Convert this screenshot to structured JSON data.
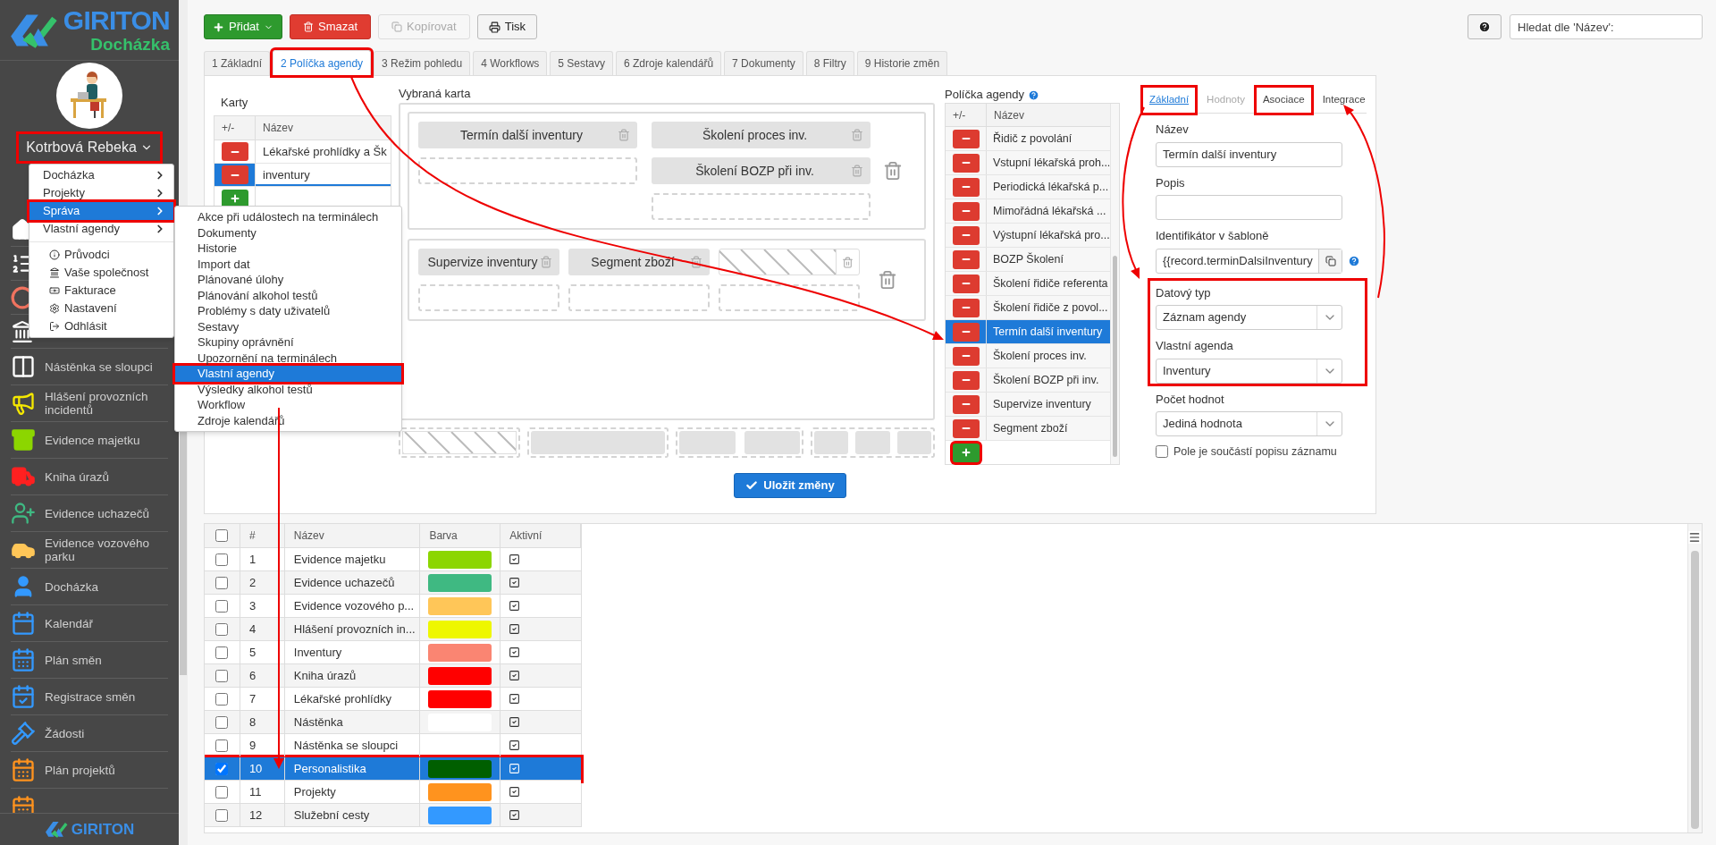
{
  "brand": {
    "name": "GIRITON",
    "product": "Docházka"
  },
  "user": {
    "name": "Kotrbová Rebeka",
    "annotated": true
  },
  "user_menu": {
    "items": [
      {
        "label": "Docházka",
        "kind": "submenu",
        "selected": false,
        "annotated": false
      },
      {
        "label": "Projekty",
        "kind": "submenu",
        "selected": false,
        "annotated": false
      },
      {
        "label": "Správa",
        "kind": "submenu",
        "selected": true,
        "annotated": true
      },
      {
        "label": "Vlastní agendy",
        "kind": "submenu",
        "selected": false,
        "annotated": false
      },
      {
        "label": "Průvodci",
        "kind": "action",
        "selected": false,
        "annotated": false
      },
      {
        "label": "Vaše společnost",
        "kind": "action",
        "selected": false,
        "annotated": false
      },
      {
        "label": "Fakturace",
        "kind": "action",
        "selected": false,
        "annotated": false
      },
      {
        "label": "Nastavení",
        "kind": "action",
        "selected": false,
        "annotated": false
      },
      {
        "label": "Odhlásit",
        "kind": "action",
        "selected": false,
        "annotated": false
      }
    ]
  },
  "submenu": {
    "items": [
      {
        "label": "Akce při událostech na terminálech",
        "selected": false,
        "annotated": false
      },
      {
        "label": "Dokumenty",
        "selected": false,
        "annotated": false
      },
      {
        "label": "Historie",
        "selected": false,
        "annotated": false
      },
      {
        "label": "Import dat",
        "selected": false,
        "annotated": false
      },
      {
        "label": "Plánované úlohy",
        "selected": false,
        "annotated": false
      },
      {
        "label": "Plánování alkohol testů",
        "selected": false,
        "annotated": false
      },
      {
        "label": "Problémy s daty uživatelů",
        "selected": false,
        "annotated": false
      },
      {
        "label": "Sestavy",
        "selected": false,
        "annotated": false
      },
      {
        "label": "Skupiny oprávnění",
        "selected": false,
        "annotated": false
      },
      {
        "label": "Upozornění na terminálech",
        "selected": false,
        "annotated": false
      },
      {
        "label": "Vlastní agendy",
        "selected": true,
        "annotated": true
      },
      {
        "label": "Výsledky alkohol testů",
        "selected": false,
        "annotated": false
      },
      {
        "label": "Workflow",
        "selected": false,
        "annotated": false
      },
      {
        "label": "Zdroje kalendářů",
        "selected": false,
        "annotated": false
      }
    ]
  },
  "sidebar": {
    "items": [
      {
        "label": "Nástěnka se sloupci"
      },
      {
        "label": "Hlášení provozních incidentů"
      },
      {
        "label": "Evidence majetku"
      },
      {
        "label": "Kniha úrazů"
      },
      {
        "label": "Evidence uchazečů"
      },
      {
        "label": "Evidence vozového parku"
      },
      {
        "label": "Docházka"
      },
      {
        "label": "Kalendář"
      },
      {
        "label": "Plán směn"
      },
      {
        "label": "Registrace směn"
      },
      {
        "label": "Žádosti"
      },
      {
        "label": "Plán projektů"
      }
    ],
    "footer_brand": "GIRITON"
  },
  "toolbar": {
    "buttons": [
      {
        "label": "Přidat",
        "kind": "add",
        "disabled": false
      },
      {
        "label": "Smazat",
        "kind": "delete",
        "disabled": false
      },
      {
        "label": "Kopírovat",
        "kind": "copy",
        "disabled": true
      },
      {
        "label": "Tisk",
        "kind": "print",
        "disabled": false
      }
    ]
  },
  "search": {
    "placeholder": "Hledat dle 'Název':"
  },
  "tabs": [
    {
      "label": "1 Základní",
      "selected": false,
      "annotated": false
    },
    {
      "label": "2 Políčka agendy",
      "selected": true,
      "annotated": true
    },
    {
      "label": "3 Režim pohledu",
      "selected": false,
      "annotated": false
    },
    {
      "label": "4 Workflows",
      "selected": false,
      "annotated": false
    },
    {
      "label": "5 Sestavy",
      "selected": false,
      "annotated": false
    },
    {
      "label": "6 Zdroje kalendářů",
      "selected": false,
      "annotated": false
    },
    {
      "label": "7 Dokumenty",
      "selected": false,
      "annotated": false
    },
    {
      "label": "8 Filtry",
      "selected": false,
      "annotated": false
    },
    {
      "label": "9 Historie změn",
      "selected": false,
      "annotated": false
    }
  ],
  "cards": {
    "title": "Karty",
    "columns": [
      "+/-",
      "Název"
    ],
    "rows": [
      {
        "name": "Lékařské prohlídky a Šk",
        "selected": false
      },
      {
        "name": "inventury",
        "selected": true
      }
    ],
    "add_button": {
      "annotated": false
    }
  },
  "selected_card": {
    "title": "Vybraná karta",
    "groups": [
      {
        "columns": [
          [
            {
              "kind": "field",
              "label": "Termín další inventury"
            },
            {
              "kind": "empty"
            }
          ],
          [
            {
              "kind": "field",
              "label": "Školení proces inv."
            },
            {
              "kind": "field",
              "label": "Školení BOZP při inv."
            },
            {
              "kind": "empty"
            }
          ]
        ]
      },
      {
        "columns": [
          [
            {
              "kind": "field",
              "label": "Supervize inventury"
            },
            {
              "kind": "empty"
            }
          ],
          [
            {
              "kind": "field",
              "label": "Segment zboží"
            },
            {
              "kind": "empty"
            }
          ],
          [
            {
              "kind": "hatched"
            },
            {
              "kind": "empty"
            }
          ]
        ]
      }
    ],
    "layouts": [
      {
        "kind": "hatched"
      },
      {
        "kind": "one"
      },
      {
        "kind": "two"
      },
      {
        "kind": "three"
      }
    ]
  },
  "save_button": "Uložit změny",
  "fields_panel": {
    "title": "Políčka agendy",
    "columns": [
      "+/-",
      "Název"
    ],
    "rows": [
      {
        "name": "Řidič z povolání",
        "selected": false
      },
      {
        "name": "Vstupní lékařská proh...",
        "selected": false
      },
      {
        "name": "Periodická lékařská p...",
        "selected": false
      },
      {
        "name": "Mimořádná lékařská ...",
        "selected": false
      },
      {
        "name": "Výstupní lékařská pro...",
        "selected": false
      },
      {
        "name": "BOZP Školení",
        "selected": false
      },
      {
        "name": "Školení řidiče referenta",
        "selected": false
      },
      {
        "name": "Školení řidiče z povol...",
        "selected": false
      },
      {
        "name": "Termín další inventury",
        "selected": true
      },
      {
        "name": "Školení proces inv.",
        "selected": false
      },
      {
        "name": "Školení BOZP při inv.",
        "selected": false
      },
      {
        "name": "Supervize inventury",
        "selected": false
      },
      {
        "name": "Segment zboží",
        "selected": false
      }
    ],
    "add_button": {
      "annotated": true
    }
  },
  "detail": {
    "tabs": [
      {
        "label": "Základní",
        "selected": true,
        "disabled": false,
        "annotated": true
      },
      {
        "label": "Hodnoty",
        "selected": false,
        "disabled": true,
        "annotated": false
      },
      {
        "label": "Asociace",
        "selected": false,
        "disabled": false,
        "annotated": true
      },
      {
        "label": "Integrace",
        "selected": false,
        "disabled": false,
        "annotated": false
      }
    ],
    "fields": [
      {
        "kind": "text",
        "label": "Název",
        "value": "Termín další inventury",
        "annotated": false
      },
      {
        "kind": "text",
        "label": "Popis",
        "annotated": false
      },
      {
        "kind": "template",
        "label": "Identifikátor v šabloně",
        "value": "{{record.terminDalsiInventury",
        "annotated": false
      },
      {
        "kind": "select",
        "label": "Datový typ",
        "value": "Záznam agendy",
        "annotated": true
      },
      {
        "kind": "select",
        "label": "Vlastní agenda",
        "value": "Inventury",
        "annotated": true
      },
      {
        "kind": "select",
        "label": "Počet hodnot",
        "value": "Jediná hodnota",
        "annotated": false
      }
    ],
    "checkbox": {
      "label": "Pole je součástí popisu záznamu",
      "checked": false
    }
  },
  "agendas_table": {
    "header_checked": false,
    "columns": [
      "#",
      "Název",
      "Barva",
      "Aktivní"
    ],
    "rows": [
      {
        "number": "1",
        "name": "Evidence majetku",
        "color": "#8cd600",
        "active": true,
        "selected": false,
        "annotated": false
      },
      {
        "number": "2",
        "name": "Evidence uchazečů",
        "color": "#3fb982",
        "active": true,
        "selected": false,
        "annotated": false
      },
      {
        "number": "3",
        "name": "Evidence vozového p...",
        "color": "#ffc658",
        "active": true,
        "selected": false,
        "annotated": false
      },
      {
        "number": "4",
        "name": "Hlášení provozních in...",
        "color": "#eef700",
        "active": true,
        "selected": false,
        "annotated": false
      },
      {
        "number": "5",
        "name": "Inventury",
        "color": "#fa8572",
        "active": true,
        "selected": false,
        "annotated": false
      },
      {
        "number": "6",
        "name": "Kniha úrazů",
        "color": "#ff0000",
        "active": true,
        "selected": false,
        "annotated": false
      },
      {
        "number": "7",
        "name": "Lékařské prohlídky",
        "color": "#ff0000",
        "active": true,
        "selected": false,
        "annotated": false
      },
      {
        "number": "8",
        "name": "Nástěnka",
        "color": "#ffffff",
        "active": true,
        "selected": false,
        "annotated": false
      },
      {
        "number": "9",
        "name": "Nástěnka se sloupci",
        "active": true,
        "selected": false,
        "annotated": false
      },
      {
        "number": "10",
        "name": "Personalistika",
        "color": "#005f00",
        "active": true,
        "selected": true,
        "annotated": true
      },
      {
        "number": "11",
        "name": "Projekty",
        "color": "#ff931e",
        "active": true,
        "selected": false,
        "annotated": false
      },
      {
        "number": "12",
        "name": "Služební cesty",
        "color": "#3399ff",
        "active": true,
        "selected": false,
        "annotated": false
      }
    ]
  }
}
